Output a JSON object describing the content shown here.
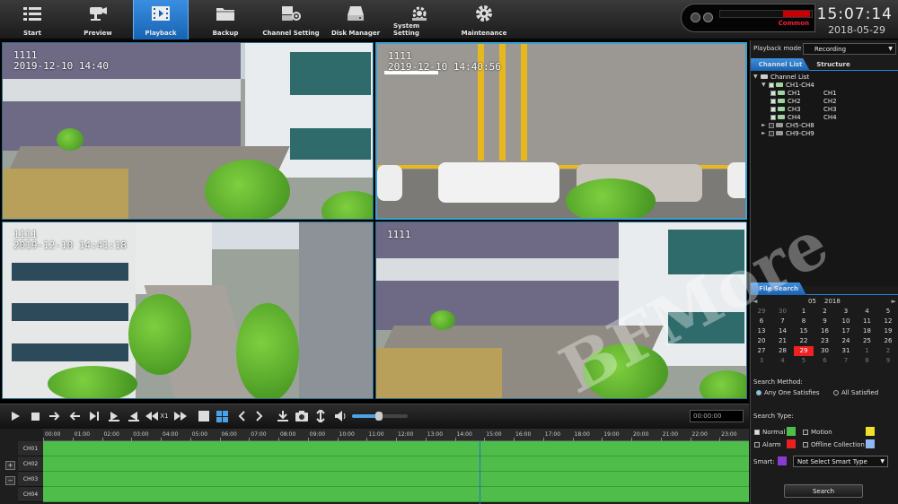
{
  "nav": [
    {
      "label": "Start",
      "icon": "menu-icon"
    },
    {
      "label": "Preview",
      "icon": "camera-icon"
    },
    {
      "label": "Playback",
      "icon": "film-icon"
    },
    {
      "label": "Backup",
      "icon": "folder-icon"
    },
    {
      "label": "Channel Setting",
      "icon": "channel-settings-icon"
    },
    {
      "label": "Disk Manager",
      "icon": "disk-icon"
    },
    {
      "label": "System Setting",
      "icon": "system-settings-icon"
    },
    {
      "label": "Maintenance",
      "icon": "gear-icon"
    }
  ],
  "status": {
    "label": "Common"
  },
  "clock": {
    "time": "15:07:14",
    "date": "2018-05-29"
  },
  "cameras": [
    {
      "osd_title": "1111",
      "osd_time": "2019-12-10 14:40"
    },
    {
      "osd_title": "1111",
      "osd_time": "2019-12-10 14:40:56"
    },
    {
      "osd_title": "1111",
      "osd_time": "2019-12-10 14:41:18"
    },
    {
      "osd_title": "1111",
      "osd_time": ""
    }
  ],
  "controls": {
    "speed": "X1",
    "time_display": "00:00:00",
    "volume_fraction": 0.48
  },
  "timeline": {
    "ticks": [
      "00:00",
      "01:00",
      "02:00",
      "03:00",
      "04:00",
      "05:00",
      "06:00",
      "07:00",
      "08:00",
      "09:00",
      "10:00",
      "11:00",
      "12:00",
      "13:00",
      "14:00",
      "15:00",
      "16:00",
      "17:00",
      "18:00",
      "19:00",
      "20:00",
      "21:00",
      "22:00",
      "23:00"
    ],
    "channels": [
      "CH01",
      "CH02",
      "CH03",
      "CH04"
    ],
    "cursor_hour": 14.85,
    "zoom_in": "+",
    "zoom_out": "−"
  },
  "panel": {
    "playback_mode_label": "Playback mode",
    "playback_mode_value": "Recording",
    "tabs": [
      "Channel List",
      "Structure"
    ],
    "tree": {
      "root": "Channel List",
      "group1": "CH1-CH4",
      "channels": [
        [
          "CH1",
          "CH1"
        ],
        [
          "CH2",
          "CH2"
        ],
        [
          "CH3",
          "CH3"
        ],
        [
          "CH4",
          "CH4"
        ]
      ],
      "group2": "CH5-CH8",
      "group3": "CH9-CH9"
    },
    "file_search_tab": "File Search",
    "calendar": {
      "month": "05",
      "year": "2018",
      "prev": "◄",
      "next": "►",
      "days": [
        [
          "29",
          "30",
          "1",
          "2",
          "3",
          "4",
          "5"
        ],
        [
          "6",
          "7",
          "8",
          "9",
          "10",
          "11",
          "12"
        ],
        [
          "13",
          "14",
          "15",
          "16",
          "17",
          "18",
          "19"
        ],
        [
          "20",
          "21",
          "22",
          "23",
          "24",
          "25",
          "26"
        ],
        [
          "27",
          "28",
          "29",
          "30",
          "31",
          "1",
          "2"
        ],
        [
          "3",
          "4",
          "5",
          "6",
          "7",
          "8",
          "9"
        ]
      ],
      "highlight": "29"
    },
    "search_method_label": "Search Method:",
    "method_any": "Any One Satisfies",
    "method_all": "All Satisfied",
    "search_type_label": "Search Type:",
    "types": [
      {
        "label": "Normal",
        "color": "#4fbd4a",
        "checked": true
      },
      {
        "label": "Motion",
        "color": "#f0e02a",
        "checked": false
      },
      {
        "label": "Alarm",
        "color": "#e82020",
        "checked": false
      },
      {
        "label": "Offline Collection",
        "color": "#8fb8f0",
        "checked": false
      }
    ],
    "smart_label": "Smart:",
    "smart_color": "#8a3ad0",
    "smart_value": "Not Select Smart Type",
    "search_button": "Search"
  },
  "watermark": "BFMore"
}
